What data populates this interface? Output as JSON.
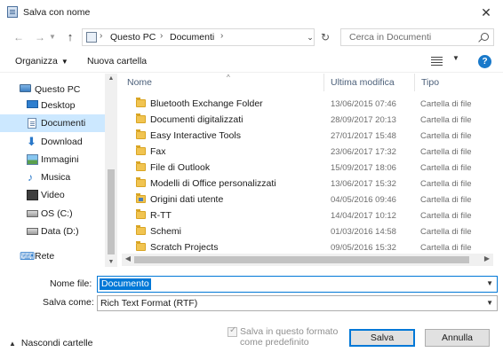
{
  "window": {
    "title": "Salva con nome",
    "close_label": "✕"
  },
  "nav": {
    "back_label": "←",
    "forward_label": "→",
    "up_label": "↑",
    "address": [
      "Questo PC",
      "Documenti"
    ],
    "address_sep": "›",
    "address_dropdown": "⌄",
    "refresh_label": "↻",
    "search_placeholder": "Cerca in Documenti"
  },
  "toolbar": {
    "organize_label": "Organizza",
    "new_folder_label": "Nuova cartella",
    "caret": "▼",
    "help_label": "?"
  },
  "sidebar": {
    "items": [
      {
        "label": "Questo PC",
        "icon": "pc-icon"
      },
      {
        "label": "Desktop",
        "icon": "desktop-icon"
      },
      {
        "label": "Documenti",
        "icon": "documents-icon",
        "selected": true
      },
      {
        "label": "Download",
        "icon": "download-icon"
      },
      {
        "label": "Immagini",
        "icon": "pictures-icon"
      },
      {
        "label": "Musica",
        "icon": "music-icon"
      },
      {
        "label": "Video",
        "icon": "video-icon"
      },
      {
        "label": "OS (C:)",
        "icon": "drive-icon"
      },
      {
        "label": "Data (D:)",
        "icon": "drive-icon"
      },
      {
        "label": "Rete",
        "icon": "network-icon"
      }
    ]
  },
  "files": {
    "columns": {
      "name": "Nome",
      "modified": "Ultima modifica",
      "type": "Tipo"
    },
    "sort_arrow": "^",
    "rows": [
      {
        "name": "Bluetooth Exchange Folder",
        "modified": "13/06/2015 07:46",
        "type": "Cartella di file"
      },
      {
        "name": "Documenti digitalizzati",
        "modified": "28/09/2017 20:13",
        "type": "Cartella di file"
      },
      {
        "name": "Easy Interactive Tools",
        "modified": "27/01/2017 15:48",
        "type": "Cartella di file"
      },
      {
        "name": "Fax",
        "modified": "23/06/2017 17:32",
        "type": "Cartella di file"
      },
      {
        "name": "File di Outlook",
        "modified": "15/09/2017 18:06",
        "type": "Cartella di file"
      },
      {
        "name": "Modelli di Office personalizzati",
        "modified": "13/06/2017 15:32",
        "type": "Cartella di file"
      },
      {
        "name": "Origini dati utente",
        "modified": "04/05/2016 09:46",
        "type": "Cartella di file"
      },
      {
        "name": "R-TT",
        "modified": "14/04/2017 10:12",
        "type": "Cartella di file"
      },
      {
        "name": "Schemi",
        "modified": "01/03/2016 14:58",
        "type": "Cartella di file"
      },
      {
        "name": "Scratch Projects",
        "modified": "09/05/2016 15:32",
        "type": "Cartella di file"
      }
    ]
  },
  "form": {
    "filename_label": "Nome file:",
    "filename_value": "Documento",
    "savetype_label": "Salva come:",
    "savetype_value": "Rich Text Format (RTF)",
    "default_format_label": "Salva in questo formato come predefinito",
    "save_label": "Salva",
    "cancel_label": "Annulla",
    "hide_folders_label": "Nascondi cartelle"
  }
}
